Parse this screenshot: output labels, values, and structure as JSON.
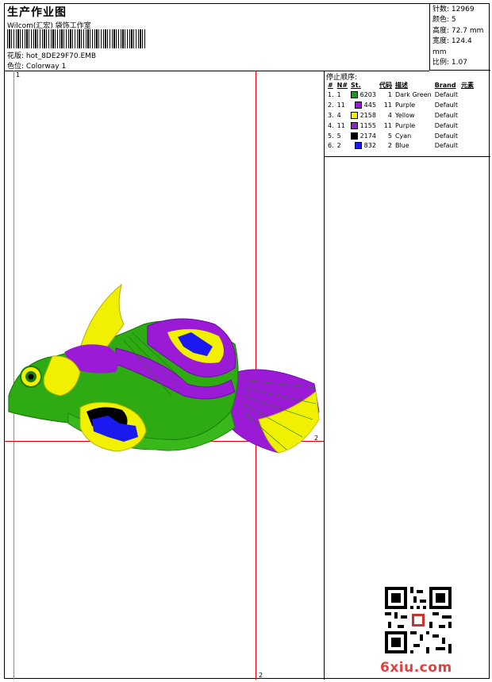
{
  "header": {
    "title": "生产作业图",
    "subtitle": "Wilcom(汇宏) 袋饰工作室",
    "design_label": "花版:",
    "design_file": "hot_8DE29F70.EMB",
    "colorway_label": "色位:",
    "colorway": "Colorway 1"
  },
  "stats": [
    {
      "label": "针数:",
      "value": "12969"
    },
    {
      "label": "颜色:",
      "value": "5"
    },
    {
      "label": "高度:",
      "value": "72.7 mm"
    },
    {
      "label": "宽度:",
      "value": "124.4 mm"
    },
    {
      "label": "比例:",
      "value": "1.07"
    }
  ],
  "canvas": {
    "marker_top_left": "1",
    "marker_right": "2",
    "marker_bottom": "2"
  },
  "sequence": {
    "title": "停止顺序:",
    "columns": [
      "#",
      "N#",
      "St.",
      "代码",
      "描述",
      "Brand",
      "元素"
    ],
    "rows": [
      {
        "idx": "1.",
        "n": "1",
        "color": "#1a9a1a",
        "stitches": "6203",
        "code": "1",
        "desc": "Dark Green",
        "brand": "Default"
      },
      {
        "idx": "2.",
        "n": "11",
        "color": "#9a1ad6",
        "stitches": "445",
        "code": "11",
        "desc": "Purple",
        "brand": "Default"
      },
      {
        "idx": "3.",
        "n": "4",
        "color": "#f0f000",
        "stitches": "2158",
        "code": "4",
        "desc": "Yellow",
        "brand": "Default"
      },
      {
        "idx": "4.",
        "n": "11",
        "color": "#9a1ad6",
        "stitches": "1155",
        "code": "11",
        "desc": "Purple",
        "brand": "Default"
      },
      {
        "idx": "5.",
        "n": "5",
        "color": "#000000",
        "stitches": "2174",
        "code": "5",
        "desc": "Cyan",
        "brand": "Default"
      },
      {
        "idx": "6.",
        "n": "2",
        "color": "#1a1af0",
        "stitches": "832",
        "code": "2",
        "desc": "Blue",
        "brand": "Default"
      }
    ]
  },
  "watermark": {
    "site": "6xiu.com"
  }
}
